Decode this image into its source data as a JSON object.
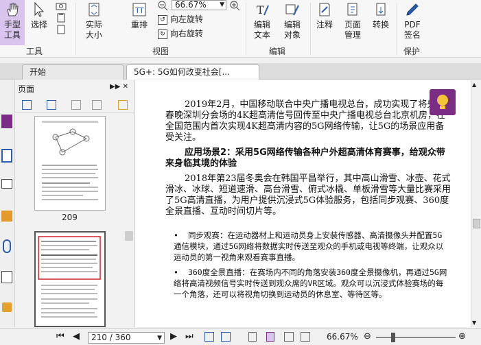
{
  "ribbon": {
    "hand_tool": "手型\n工具",
    "select": "选择",
    "actual_size": "实际\n大小",
    "reflow": "重排",
    "zoom_value": "66.67%",
    "rotate_left": "向左旋转",
    "rotate_right": "向右旋转",
    "edit_text": "编辑\n文本",
    "edit_object": "编辑\n对象",
    "annotate": "注释",
    "page_manage": "页面\n管理",
    "convert": "转换",
    "pdf_sign": "PDF\n签名",
    "group_tools": "工具",
    "group_view": "视图",
    "group_edit": "编辑",
    "group_protect": "保护"
  },
  "tabs": [
    {
      "label": "开始"
    },
    {
      "label": "5G+: 5G如何改变社会[..."
    }
  ],
  "panel": {
    "title": "页面",
    "thumb_label_1": "209"
  },
  "document": {
    "p1": "2019年2月，中国移动联合中央广播电视总台，成功实现了将央视春晚深圳分会场的4K超高清信号回传至中央广播电视总台北京机房，在全国范围内首次实现4K超高清内容的5G网络传输，让5G的场景应用备受关注。",
    "h2": "应用场景2：采用5G网络传输各种户外超高清体育赛事，给观众带来身临其境的体验",
    "p2": "2018年第23届冬奥会在韩国平昌举行，其中高山滑雪、冰壶、花式滑冰、冰球、短道速滑、高台滑雪、俯式冰橇、单板滑雪等大量比赛采用了5G高清直播，为用户提供沉浸式5G体验服务，包括同步观赛、360度全景直播、互动时间切片等。",
    "b1": "同步观赛：在运动器材上和运动员身上安装传感器、高清摄像头并配置5G通信模块，通过5G网络将数据实时传送至观众的手机或电视等终端，让观众以运动员的第一视角来观看赛事直播。",
    "b2": "360度全景直播：在赛场内不同的角落安装360度全景摄像机，再通过5G网络将高清视频信号实时传送到观众席的VR区域。观众可以沉浸式体验赛场的每一个角落，还可以将视角切换到运动员的休息室、等待区等。"
  },
  "status": {
    "page_indicator": "210 / 360",
    "zoom": "66.67%"
  },
  "colors": {
    "accent_purple": "#7b2d86",
    "active_tool_bg": "#d9c4ee",
    "icon_blue": "#2a5db0",
    "selection_red": "#d0202a"
  }
}
